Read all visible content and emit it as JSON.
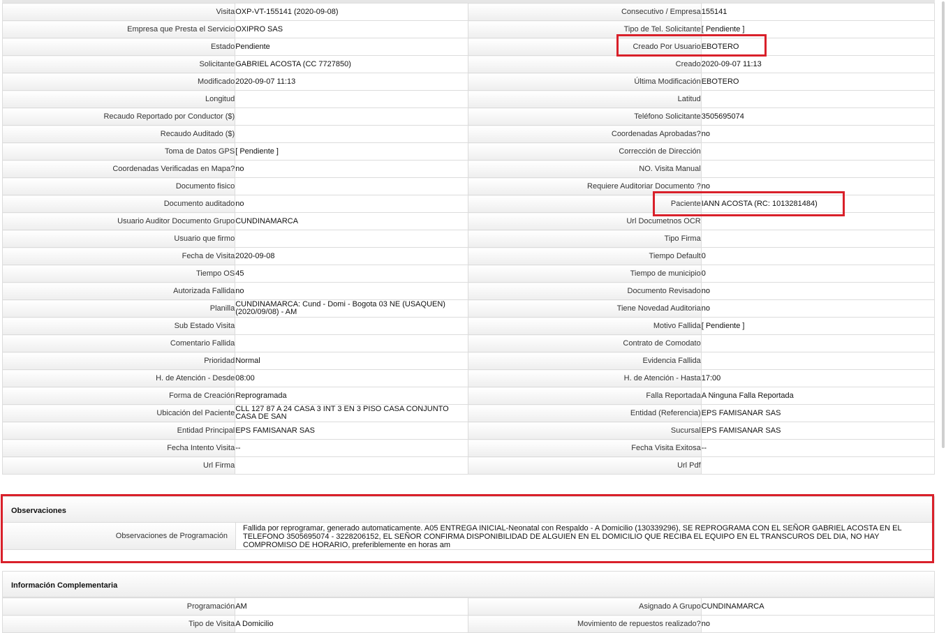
{
  "details": {
    "rows": [
      {
        "l1": "Visita",
        "v1": "OXP-VT-155141 (2020-09-08)",
        "l2": "Consecutivo / Empresa",
        "v2": "155141"
      },
      {
        "l1": "Empresa que Presta el Servicio",
        "v1": "OXIPRO SAS",
        "l2": "Tipo de Tel. Solicitante",
        "v2": "[ Pendiente ]"
      },
      {
        "l1": "Estado",
        "v1": "Pendiente",
        "l2": "Creado Por Usuario",
        "v2": "EBOTERO"
      },
      {
        "l1": "Solicitante",
        "v1": "GABRIEL ACOSTA (CC 7727850)",
        "l2": "Creado",
        "v2": "2020-09-07 11:13"
      },
      {
        "l1": "Modificado",
        "v1": "2020-09-07 11:13",
        "l2": "Última Modificación",
        "v2": " EBOTERO"
      },
      {
        "l1": "Longitud",
        "v1": "",
        "l2": "Latitud",
        "v2": ""
      },
      {
        "l1": "Recaudo Reportado por Conductor ($)",
        "v1": "",
        "l2": "Teléfono Solicitante",
        "v2": "3505695074"
      },
      {
        "l1": "Recaudo Auditado ($)",
        "v1": "",
        "l2": "Coordenadas Aprobadas?",
        "v2": " no"
      },
      {
        "l1": "Toma de Datos GPS",
        "v1": "[ Pendiente ]",
        "l2": "Corrección de Dirección",
        "v2": ""
      },
      {
        "l1": "Coordenadas Verificadas en Mapa?",
        "v1": " no",
        "l2": "NO. Visita Manual",
        "v2": ""
      },
      {
        "l1": "Documento fisico",
        "v1": "",
        "l2": "Requiere Auditoriar Documento ?",
        "v2": " no"
      },
      {
        "l1": "Documento auditado",
        "v1": " no",
        "l2": "Paciente",
        "v2": "IANN ACOSTA (RC: 1013281484)"
      },
      {
        "l1": "Usuario Auditor Documento Grupo",
        "v1": "CUNDINAMARCA",
        "l2": "Url Documetnos OCR",
        "v2": ""
      },
      {
        "l1": "Usuario que firmo",
        "v1": "",
        "l2": "Tipo Firma",
        "v2": ""
      },
      {
        "l1": "Fecha de Visita",
        "v1": " 2020-09-08",
        "l2": "Tiempo Default",
        "v2": "0"
      },
      {
        "l1": "Tiempo OS",
        "v1": "45",
        "l2": "Tiempo de municipio",
        "v2": "0"
      },
      {
        "l1": "Autorizada Fallida",
        "v1": " no",
        "l2": "Documento Revisado",
        "v2": " no"
      },
      {
        "l1": "Planilla",
        "v1": "CUNDINAMARCA: Cund - Domi - Bogota 03 NE (USAQUEN) (2020/09/08) - AM",
        "l2": "Tiene Novedad Auditoria",
        "v2": " no"
      },
      {
        "l1": "Sub Estado Visita",
        "v1": "",
        "l2": "Motivo Fallida",
        "v2": "[ Pendiente ]"
      },
      {
        "l1": "Comentario Fallida",
        "v1": "",
        "l2": "Contrato de Comodato",
        "v2": ""
      },
      {
        "l1": "Prioridad",
        "v1": "Normal",
        "l2": "Evidencia Fallida",
        "v2": ""
      },
      {
        "l1": "H. de Atención - Desde",
        "v1": "08:00",
        "l2": "H. de Atención - Hasta",
        "v2": "17:00"
      },
      {
        "l1": "Forma de Creación",
        "v1": "Reprogramada",
        "l2": "Falla Reportada",
        "v2": "A Ninguna Falla Reportada"
      },
      {
        "l1": "Ubicación del Paciente",
        "v1": "CLL 127 87 A 24 CASA 3 INT 3 EN 3 PISO CASA CONJUNTO CASA DE SAN",
        "l2": "Entidad (Referencia)",
        "v2": "EPS FAMISANAR SAS"
      },
      {
        "l1": "Entidad Principal",
        "v1": "EPS FAMISANAR SAS",
        "l2": "Sucursal",
        "v2": "EPS FAMISANAR SAS"
      },
      {
        "l1": "Fecha Intento Visita",
        "v1": " --",
        "l2": "Fecha Visita Exitosa",
        "v2": " --"
      },
      {
        "l1": "Url Firma",
        "v1": "",
        "l2": "Url Pdf",
        "v2": ""
      }
    ]
  },
  "observaciones": {
    "title": "Observaciones",
    "label": "Observaciones de Programación",
    "text": "  Fallida por reprogramar, generado automaticamente. A05 ENTREGA INICIAL-Neonatal con Respaldo - A Domicilio (130339296), SE REPROGRAMA CON EL SEÑOR GABRIEL ACOSTA EN EL TELEFONO 3505695074 - 3228206152, EL SEÑOR CONFIRMA DISPONIBILIDAD DE ALGUIEN EN EL DOMICILIO QUE RECIBA EL EQUIPO EN EL TRANSCUROS DEL DIA, NO HAY COMPROMISO DE HORARIO, preferiblemente en horas am"
  },
  "complementaria": {
    "title": "Información Complementaria",
    "rows": [
      {
        "l1": "Programación",
        "v1": "AM",
        "l2": "Asignado A Grupo",
        "v2": "CUNDINAMARCA"
      },
      {
        "l1": "Tipo de Visita",
        "v1": "A Domicilio",
        "l2": "Movimiento de repuestos realizado?",
        "v2": " no"
      }
    ]
  },
  "highlight_color": "#d9202a"
}
